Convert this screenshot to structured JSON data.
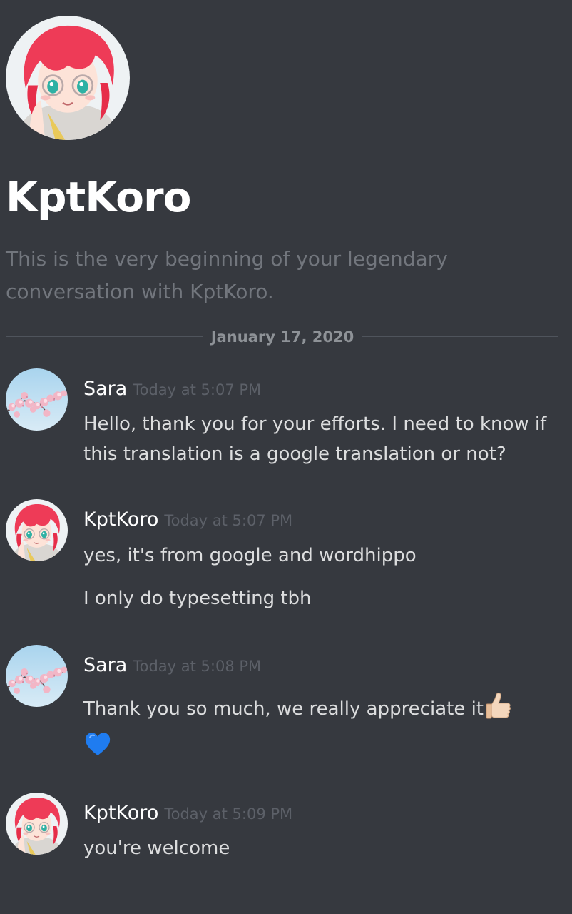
{
  "channel": {
    "title": "KptKoro",
    "intro": "This is the very beginning of your legendary conversation with KptKoro.",
    "date_divider": "January 17, 2020"
  },
  "avatars": {
    "kptkoro": "anime-girl-red-hair-avatar",
    "sara": "cherry-blossom-avatar"
  },
  "messages": [
    {
      "author": "Sara",
      "timestamp": "Today at 5:07 PM",
      "lines": [
        "Hello, thank you for your efforts. I need to know if this translation is a google translation or not?"
      ]
    },
    {
      "author": "KptKoro",
      "timestamp": "Today at 5:07 PM",
      "lines": [
        "yes, it's from google and wordhippo",
        "I only do typesetting tbh"
      ]
    },
    {
      "author": "Sara",
      "timestamp": "Today at 5:08 PM",
      "lines": [
        "Thank you so much, we really appreciate it"
      ],
      "emojis": [
        "thumbs-up-icon",
        "blue-heart-icon"
      ]
    },
    {
      "author": "KptKoro",
      "timestamp": "Today at 5:09 PM",
      "lines": [
        "you're welcome"
      ]
    }
  ],
  "colors": {
    "background": "#36393f",
    "author": "#ffffff",
    "text": "#dcddde",
    "muted": "#72767d",
    "timestamp": "#5c6068",
    "divider": "#4f545c",
    "heart": "#1f7cf0"
  }
}
